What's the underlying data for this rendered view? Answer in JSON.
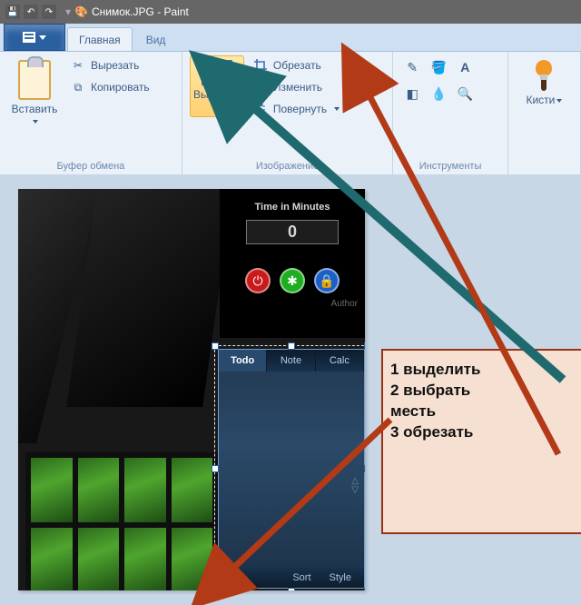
{
  "title": {
    "filename": "Снимок.JPG",
    "app": "Paint"
  },
  "tabs": {
    "home": "Главная",
    "view": "Вид"
  },
  "ribbon": {
    "clipboard": {
      "paste": "Вставить",
      "cut": "Вырезать",
      "copy": "Копировать",
      "group": "Буфер обмена"
    },
    "image": {
      "select": "Выдели",
      "crop": "Обрезать",
      "resize": "Изменить",
      "rotate": "Повернуть",
      "group": "Изображение"
    },
    "tools": {
      "group": "Инструменты"
    },
    "brushes": {
      "label": "Кисти"
    }
  },
  "gadget_timer": {
    "title": "Time in Minutes",
    "value": "0",
    "author": "Author"
  },
  "gadget_notes": {
    "tabs": [
      "Todo",
      "Note",
      "Calc"
    ],
    "footer": [
      "Sort",
      "Style"
    ]
  },
  "annotation": {
    "line1": "1 выделить",
    "line2": "2 выбрать",
    "line3": "месть",
    "line4": "3 обрезать"
  }
}
